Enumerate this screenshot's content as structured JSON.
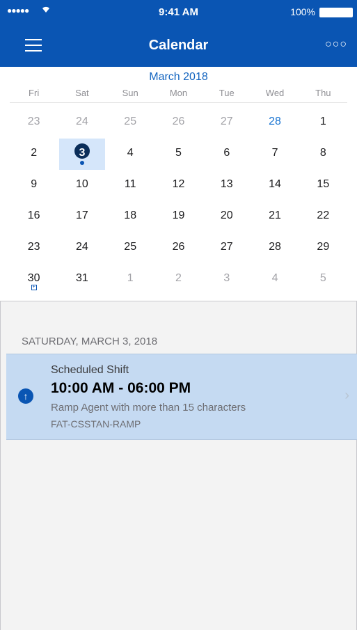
{
  "status_bar": {
    "signal": "●●●●●",
    "wifi": "wifi-icon",
    "time": "9:41 AM",
    "battery": "100%"
  },
  "nav": {
    "title": "Calendar",
    "menu_icon": "hamburger-icon",
    "more_icon": "more-icon",
    "more_glyph": "○○○"
  },
  "calendar": {
    "month": "March 2018",
    "weekdays": [
      "Fri",
      "Sat",
      "Sun",
      "Mon",
      "Tue",
      "Wed",
      "Thu"
    ],
    "weeks": [
      [
        "23",
        "24",
        "25",
        "26",
        "27",
        "28",
        "1"
      ],
      [
        "2",
        "3",
        "4",
        "5",
        "6",
        "7",
        "8"
      ],
      [
        "9",
        "10",
        "11",
        "12",
        "13",
        "14",
        "15"
      ],
      [
        "16",
        "17",
        "18",
        "19",
        "20",
        "21",
        "22"
      ],
      [
        "23",
        "24",
        "25",
        "26",
        "27",
        "28",
        "29"
      ],
      [
        "30",
        "31",
        "1",
        "2",
        "3",
        "4",
        "5"
      ]
    ],
    "today_label": "28",
    "selected_label": "3"
  },
  "section_header": "SATURDAY, MARCH 3, 2018",
  "shift": {
    "label": "Scheduled Shift",
    "time": "10:00 AM - 06:00 PM",
    "role": "Ramp Agent with more than 15 characters",
    "code": "FAT-CSSTAN-RAMP",
    "icon": "arrow-up-icon",
    "chevron": "chevron-right-icon"
  },
  "colors": {
    "brand": "#0a55b3",
    "selected_bg": "#d5e6fa",
    "card_bg": "#c5daf2",
    "today": "#1773d1"
  }
}
